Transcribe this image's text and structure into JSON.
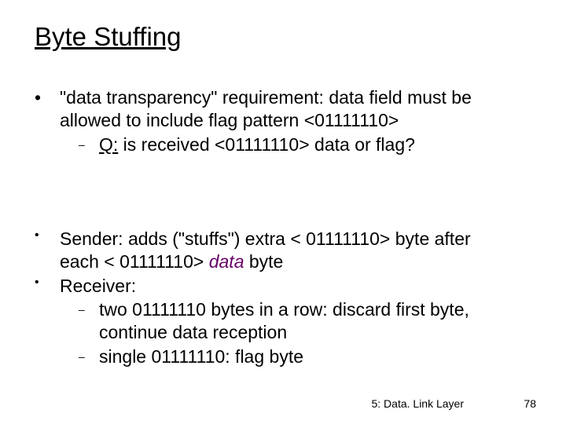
{
  "title": "Byte Stuffing",
  "block1": {
    "line1a": " \"data transparency\" requirement: data field must be",
    "line1b": "allowed to include flag pattern  <01111110>",
    "q_label": "Q:",
    "q_rest": " is received <01111110> data or flag?"
  },
  "block2": {
    "senderA": "Sender: adds (\"stuffs\") extra < 01111110> byte after",
    "senderB": "each < 01111110> ",
    "data_word": "data",
    "senderC": "  byte",
    "receiver": "Receiver:",
    "r1a": "two 01111110 bytes in a row: discard first byte,",
    "r1b": "continue data reception",
    "r2": "single 01111110: flag byte"
  },
  "footer": {
    "section": "5: Data. Link Layer",
    "page": "78"
  }
}
